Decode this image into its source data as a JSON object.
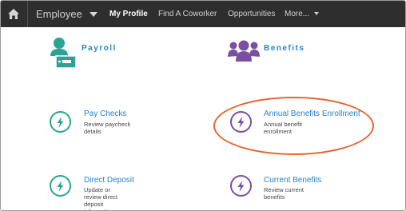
{
  "nav": {
    "menu": "Employee",
    "links": [
      "My Profile",
      "Find A Coworker",
      "Opportunities",
      "More..."
    ],
    "icons": {
      "home": "home-icon"
    }
  },
  "sections": {
    "payroll": {
      "title": "Payroll",
      "icon": "payroll-person-icon"
    },
    "benefits": {
      "title": "Benefits",
      "icon": "people-group-icon"
    }
  },
  "tiles": [
    {
      "title": "Pay Checks",
      "desc": "Review paycheck details",
      "icon": "lightning-bolt-icon",
      "color": "#2aa394"
    },
    {
      "title": "Annual Benefits Enrollment",
      "desc": "Annual benefit enrollment",
      "icon": "lightning-bolt-icon",
      "color": "#7a4fa3"
    },
    {
      "title": "Direct Deposit",
      "desc": "Update or review direct deposit information",
      "icon": "lightning-bolt-icon",
      "color": "#2aa394"
    },
    {
      "title": "Current Benefits",
      "desc": "Review current benefits",
      "icon": "lightning-bolt-icon",
      "color": "#7a4fa3"
    }
  ],
  "colors": {
    "nav_bg": "#2e2e2e",
    "link": "#2a83c9",
    "teal": "#2aa394",
    "purple": "#7a4fa3",
    "highlight": "#e8632d"
  }
}
